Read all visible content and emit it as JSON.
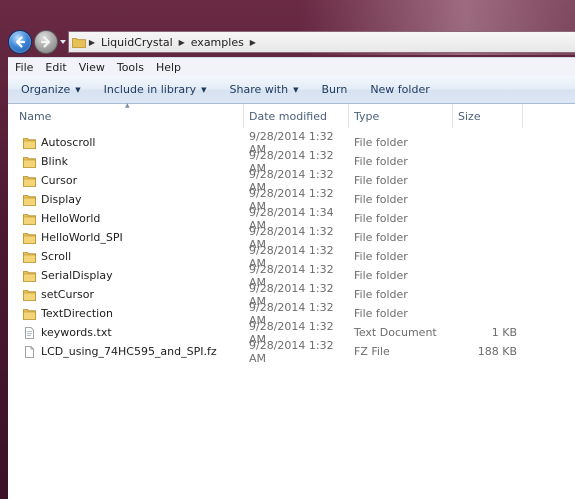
{
  "address": {
    "crumbs": [
      "LiquidCrystal",
      "examples"
    ]
  },
  "menu": [
    "File",
    "Edit",
    "View",
    "Tools",
    "Help"
  ],
  "toolbar": {
    "organize": "Organize",
    "include": "Include in library",
    "share": "Share with",
    "burn": "Burn",
    "new_folder": "New folder"
  },
  "columns": {
    "name": "Name",
    "date": "Date modified",
    "type": "Type",
    "size": "Size"
  },
  "files": [
    {
      "name": "Autoscroll",
      "date": "9/28/2014 1:32 AM",
      "type": "File folder",
      "size": "",
      "icon": "folder-icon"
    },
    {
      "name": "Blink",
      "date": "9/28/2014 1:32 AM",
      "type": "File folder",
      "size": "",
      "icon": "folder-icon"
    },
    {
      "name": "Cursor",
      "date": "9/28/2014 1:32 AM",
      "type": "File folder",
      "size": "",
      "icon": "folder-icon"
    },
    {
      "name": "Display",
      "date": "9/28/2014 1:32 AM",
      "type": "File folder",
      "size": "",
      "icon": "folder-icon"
    },
    {
      "name": "HelloWorld",
      "date": "9/28/2014 1:34 AM",
      "type": "File folder",
      "size": "",
      "icon": "folder-icon"
    },
    {
      "name": "HelloWorld_SPI",
      "date": "9/28/2014 1:32 AM",
      "type": "File folder",
      "size": "",
      "icon": "folder-icon"
    },
    {
      "name": "Scroll",
      "date": "9/28/2014 1:32 AM",
      "type": "File folder",
      "size": "",
      "icon": "folder-icon"
    },
    {
      "name": "SerialDisplay",
      "date": "9/28/2014 1:32 AM",
      "type": "File folder",
      "size": "",
      "icon": "folder-icon"
    },
    {
      "name": "setCursor",
      "date": "9/28/2014 1:32 AM",
      "type": "File folder",
      "size": "",
      "icon": "folder-icon"
    },
    {
      "name": "TextDirection",
      "date": "9/28/2014 1:32 AM",
      "type": "File folder",
      "size": "",
      "icon": "folder-icon"
    },
    {
      "name": "keywords.txt",
      "date": "9/28/2014 1:32 AM",
      "type": "Text Document",
      "size": "1 KB",
      "icon": "text-file-icon"
    },
    {
      "name": "LCD_using_74HC595_and_SPI.fz",
      "date": "9/28/2014 1:32 AM",
      "type": "FZ File",
      "size": "188 KB",
      "icon": "file-icon"
    }
  ]
}
